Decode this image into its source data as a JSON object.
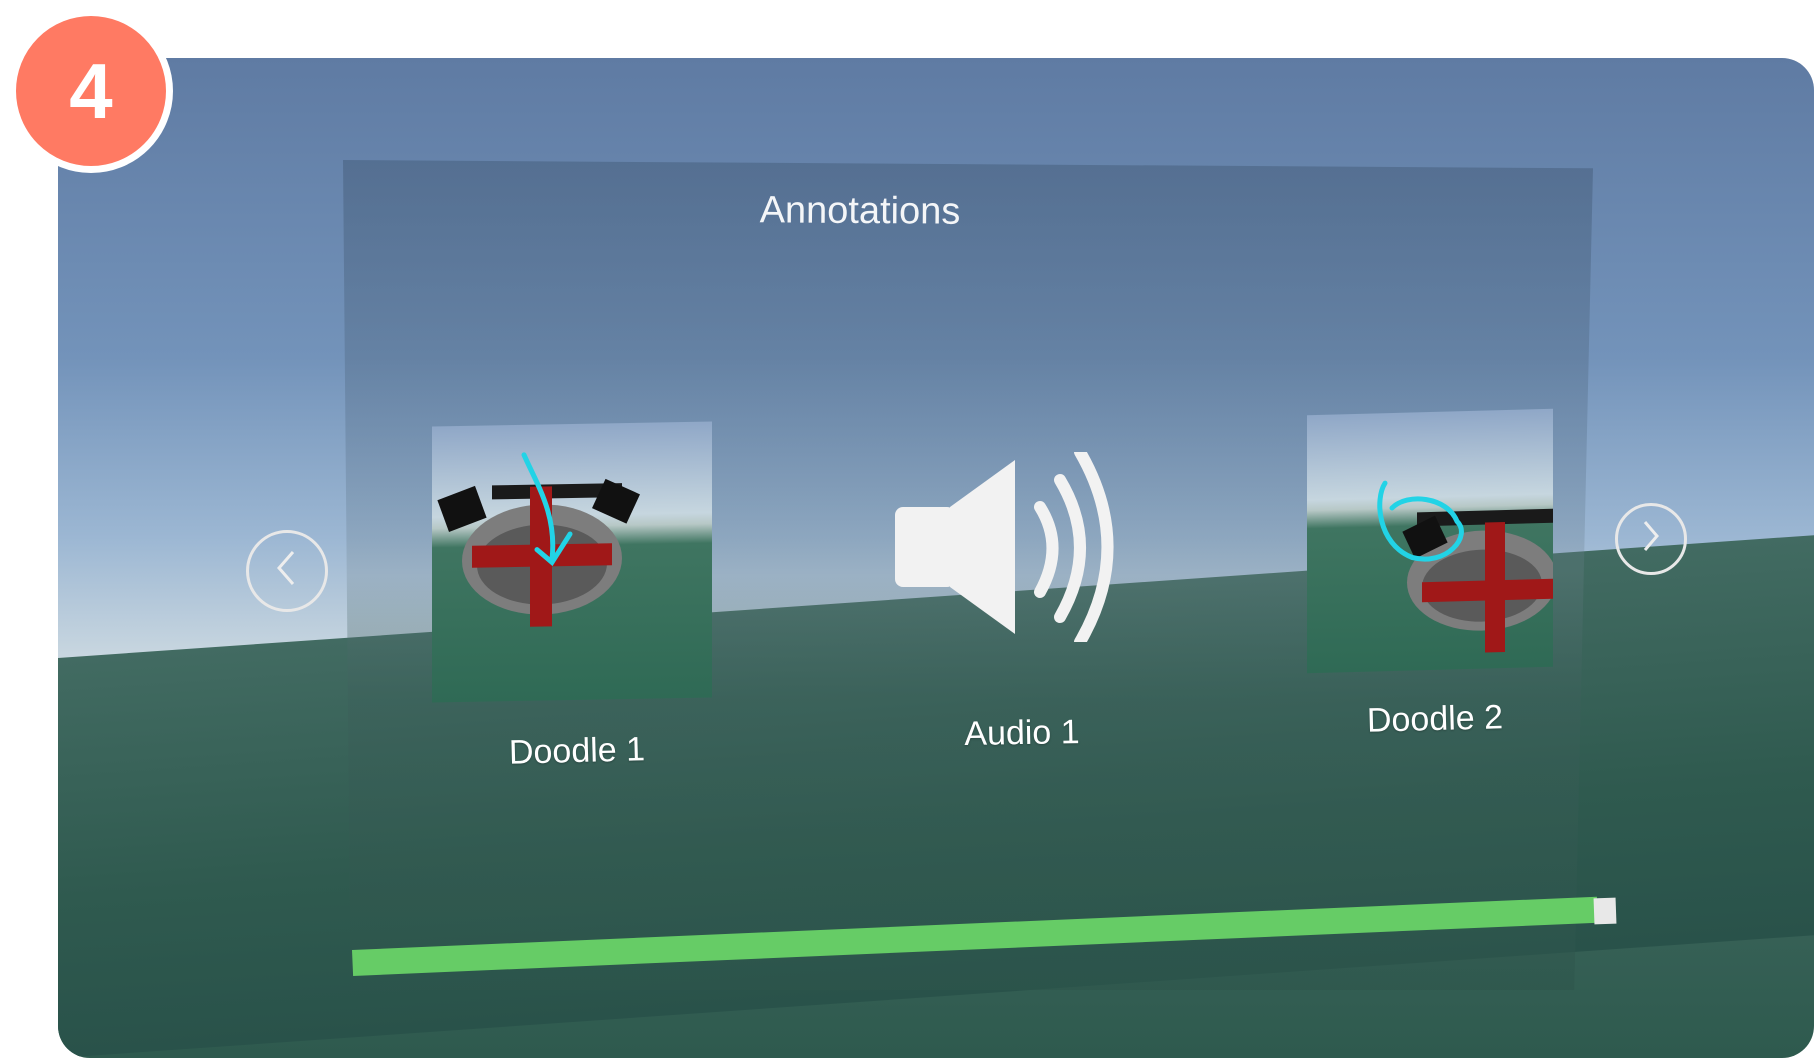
{
  "step_badge": {
    "number": "4",
    "color": "#ff7a63"
  },
  "panel": {
    "title": "Annotations",
    "nav": {
      "prev_icon": "chevron-left-icon",
      "next_icon": "chevron-right-icon"
    },
    "items": [
      {
        "label": "Doodle 1",
        "type": "doodle",
        "icon": "doodle-thumbnail"
      },
      {
        "label": "Audio 1",
        "type": "audio",
        "icon": "speaker-icon"
      },
      {
        "label": "Doodle 2",
        "type": "doodle",
        "icon": "doodle-thumbnail"
      }
    ],
    "progress": {
      "percent": 100,
      "color": "#66cc66"
    }
  },
  "colors": {
    "annotation_stroke": "#22d3e6",
    "model_cross": "#a01818"
  }
}
